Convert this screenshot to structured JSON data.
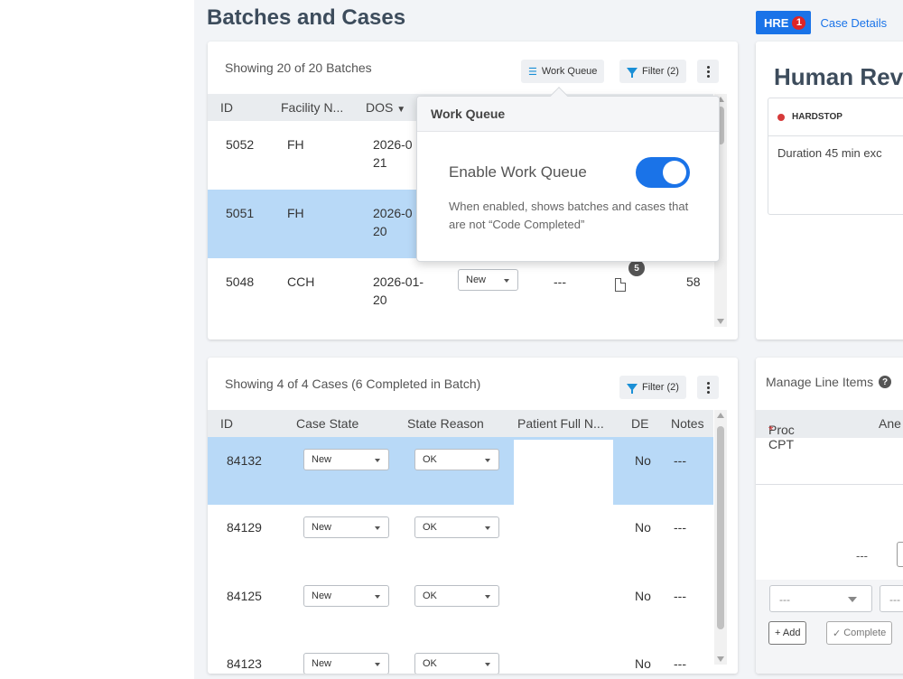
{
  "page_title": "Batches and Cases",
  "batches": {
    "count_text": "Showing 20 of 20 Batches",
    "work_queue_label": "Work Queue",
    "filter_label": "Filter (2)",
    "columns": [
      "ID",
      "Facility N...",
      "DOS"
    ],
    "rows": [
      {
        "id": "5052",
        "facility": "FH",
        "dos_line1": "2026-0",
        "dos_line2": "21"
      },
      {
        "id": "5051",
        "facility": "FH",
        "dos_line1": "2026-0",
        "dos_line2": "20"
      },
      {
        "id": "5048",
        "facility": "CCH",
        "dos_line1": "2026-01-",
        "dos_line2": "20",
        "state": "New",
        "reason": "---",
        "doc_badge": "5",
        "count": "58"
      }
    ]
  },
  "work_queue_popover": {
    "title": "Work Queue",
    "toggle_label": "Enable Work Queue",
    "enabled": true,
    "description": "When enabled, shows batches and cases that are not “Code Completed”"
  },
  "cases": {
    "count_text": "Showing 4 of 4 Cases (6 Completed in Batch)",
    "filter_label": "Filter (2)",
    "columns": [
      "ID",
      "Case State",
      "State Reason",
      "Patient Full N...",
      "DE",
      "Notes"
    ],
    "rows": [
      {
        "id": "84132",
        "state": "New",
        "reason": "OK",
        "de": "No",
        "notes": "---"
      },
      {
        "id": "84129",
        "state": "New",
        "reason": "OK",
        "de": "No",
        "notes": "---"
      },
      {
        "id": "84125",
        "state": "New",
        "reason": "OK",
        "de": "No",
        "notes": "---"
      },
      {
        "id": "84123",
        "state": "New",
        "reason": "OK",
        "de": "No",
        "notes": "---"
      }
    ]
  },
  "right_tabs": {
    "hre_label": "HRE",
    "hre_badge": "1",
    "case_details_label": "Case Details"
  },
  "review_panel": {
    "title": "Human Rev",
    "hardstop_label": "HARDSTOP",
    "hardstop_text": "Duration 45 min exc"
  },
  "line_items": {
    "title": "Manage Line Items",
    "help_icon": "?",
    "col_proc": "Proc CPT",
    "required_mark": "*",
    "col_ane": "Ane",
    "dash": "---",
    "select1": "---",
    "select2": "---",
    "add_label": "+ Add",
    "complete_label": "Complete"
  },
  "colors": {
    "accent": "#1a73e8",
    "selected_row": "#b8d9f7",
    "hardstop": "#d63a3a"
  }
}
